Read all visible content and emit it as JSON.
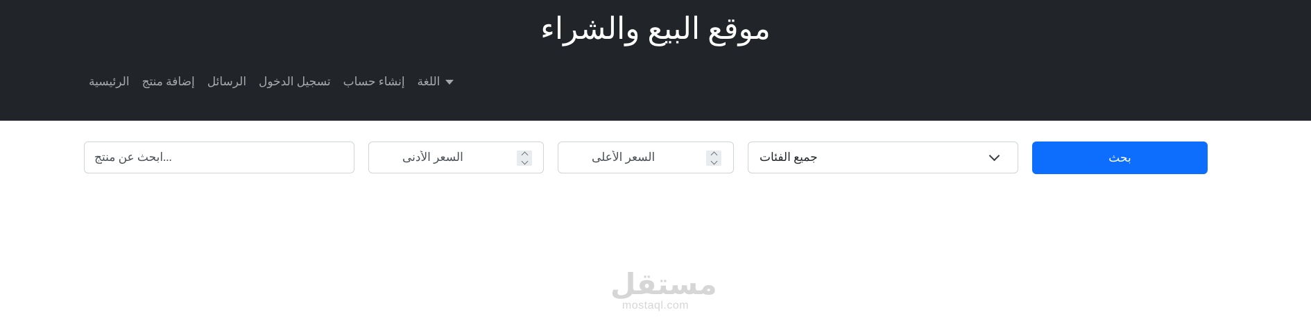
{
  "header": {
    "title": "موقع البيع والشراء",
    "nav": {
      "home": "الرئيسية",
      "add_product": "إضافة منتج",
      "messages": "الرسائل",
      "login": "تسجيل الدخول",
      "register": "إنشاء حساب",
      "language": "اللغة"
    }
  },
  "search": {
    "query_placeholder": "...ابحث عن منتج",
    "min_price_placeholder": "السعر الأدنى",
    "max_price_placeholder": "السعر الأعلى",
    "category_selected": "جميع الفئات",
    "button_label": "بحث"
  },
  "watermark": {
    "arabic": "مستقل",
    "latin": "mostaql.com"
  },
  "colors": {
    "navbar_bg": "#212529",
    "primary": "#0d6efd",
    "border": "#ced4da"
  }
}
